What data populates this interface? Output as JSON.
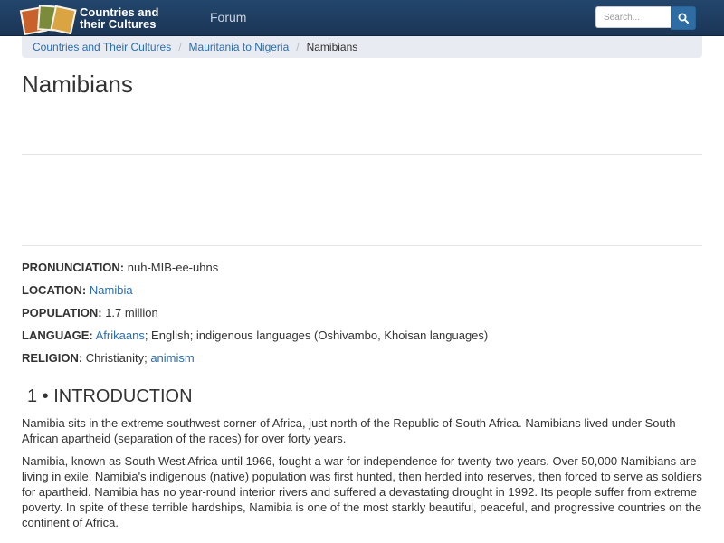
{
  "header": {
    "logo_line1": "Countries and",
    "logo_line2": "their Cultures",
    "forum_label": "Forum",
    "search_placeholder": "Search..."
  },
  "breadcrumb": {
    "items": [
      "Countries and Their Cultures",
      "Mauritania to Nigeria"
    ],
    "current": "Namibians"
  },
  "page_title": "Namibians",
  "facts": {
    "pronunciation": {
      "label": "PRONUNCIATION:",
      "value": " nuh-MIB-ee-uhns"
    },
    "location": {
      "label": "LOCATION:",
      "link": "Namibia"
    },
    "population": {
      "label": "POPULATION:",
      "value": " 1.7 million"
    },
    "language": {
      "label": "LANGUAGE:",
      "link": "Afrikaans",
      "rest": "; English; indigenous languages (Oshivambo, Khoisan languages)"
    },
    "religion": {
      "label": "RELIGION:",
      "value": " Christianity; ",
      "link": "animism"
    }
  },
  "section": {
    "title": "1 • INTRODUCTION",
    "paragraphs": [
      "Namibia sits in the extreme southwest corner of Africa, just north of the Republic of South Africa. Namibians lived under South African apartheid (separation of the races) for over forty years.",
      "Namibia, known as South West Africa until 1966, fought a war for independence for twenty-two years. Over 50,000 Namibians are living in exile. Namibia's indigenous (native) population was first hunted, then herded into reserves, then forced to serve as soldiers for apartheid. Namibia has no year-round interior rivers and suffered a devastating drought in 1992. Its people suffer from extreme poverty. In spite of these terrible hardships, Namibia is one of the most starkly beautiful, peaceful, and progressive countries on the continent of Africa."
    ]
  },
  "colors": {
    "navbar": "#1f3c5e",
    "link": "#2a6db0",
    "search_button": "#2e6da4",
    "breadcrumb_bg": "#e8ecf2"
  }
}
